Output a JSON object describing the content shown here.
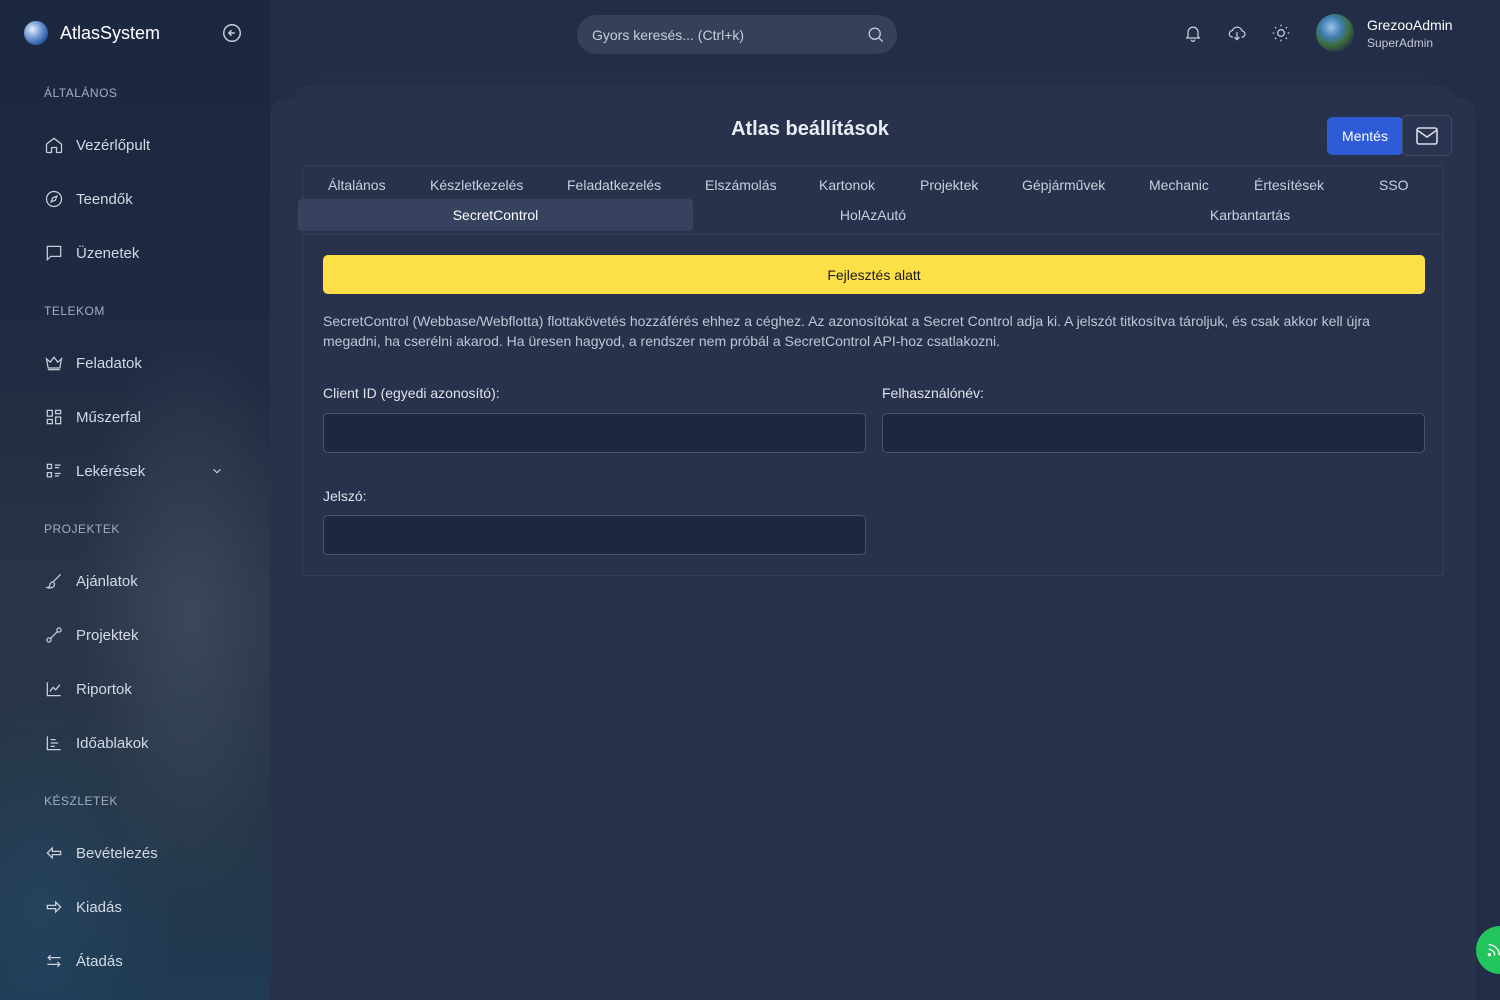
{
  "brand": {
    "name": "AtlasSystem"
  },
  "sidebar": {
    "sections": [
      {
        "label": "ÁLTALÁNOS",
        "items": [
          {
            "label": "Vezérlőpult",
            "icon": "home-icon"
          },
          {
            "label": "Teendők",
            "icon": "compass-icon"
          },
          {
            "label": "Üzenetek",
            "icon": "message-icon"
          }
        ]
      },
      {
        "label": "TELEKOM",
        "items": [
          {
            "label": "Feladatok",
            "icon": "crown-icon"
          },
          {
            "label": "Műszerfal",
            "icon": "dashboard-icon"
          },
          {
            "label": "Lekérések",
            "icon": "list-icon"
          }
        ]
      },
      {
        "label": "PROJEKTEK",
        "items": [
          {
            "label": "Ajánlatok",
            "icon": "brush-icon"
          },
          {
            "label": "Projektek",
            "icon": "route-icon"
          },
          {
            "label": "Riportok",
            "icon": "chart-icon"
          },
          {
            "label": "Időablakok",
            "icon": "timeline-icon"
          }
        ]
      },
      {
        "label": "KÉSZLETEK",
        "items": [
          {
            "label": "Bevételezés",
            "icon": "arrow-left-icon"
          },
          {
            "label": "Kiadás",
            "icon": "arrow-right-icon"
          },
          {
            "label": "Átadás",
            "icon": "swap-icon"
          }
        ]
      }
    ]
  },
  "search": {
    "placeholder": "Gyors keresés... (Ctrl+k)"
  },
  "user": {
    "name": "GrezooAdmin",
    "role": "SuperAdmin"
  },
  "page": {
    "title": "Atlas beállítások",
    "save_label": "Mentés"
  },
  "tabs": {
    "row1": [
      "Általános",
      "Készletkezelés",
      "Feladatkezelés",
      "Elszámolás",
      "Kartonok",
      "Projektek",
      "Gépjárművek",
      "Mechanic",
      "Értesítések",
      "SSO"
    ],
    "row2": [
      "SecretControl",
      "HolAzAutó",
      "Karbantartás"
    ],
    "active": "SecretControl"
  },
  "content": {
    "banner": "Fejlesztés alatt",
    "description": "SecretControl (Webbase/Webflotta) flottakövetés hozzáférés ehhez a céghez. Az azonosítókat a Secret Control adja ki. A jelszót titkosítva tároljuk, és csak akkor kell újra megadni, ha cserélni akarod. Ha üresen hagyod, a rendszer nem próbál a SecretControl API-hoz csatlakozni.",
    "fields": {
      "client_id": {
        "label": "Client ID (egyedi azonosító):",
        "value": ""
      },
      "username": {
        "label": "Felhasználónév:",
        "value": ""
      },
      "password": {
        "label": "Jelszó:",
        "value": ""
      }
    }
  },
  "colors": {
    "accent": "#2e5bd6",
    "warning": "#fde047",
    "success": "#22c55e",
    "background": "#232d47"
  }
}
